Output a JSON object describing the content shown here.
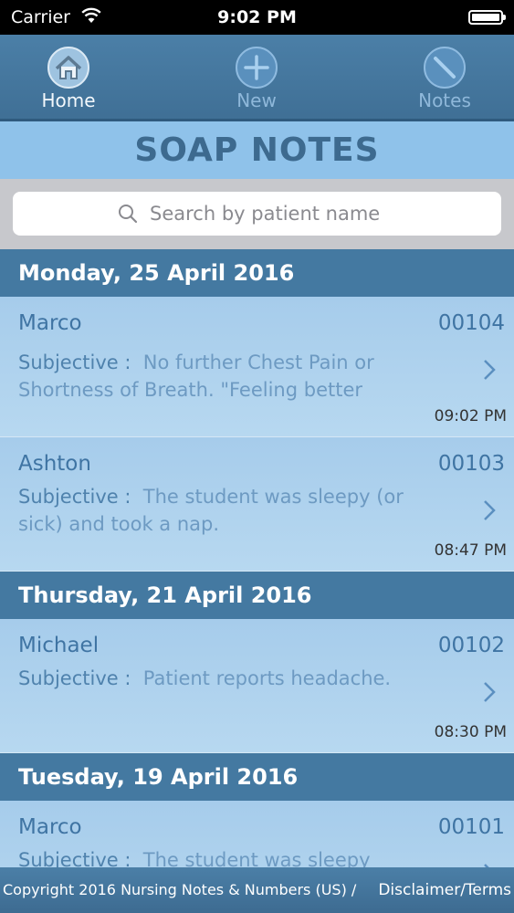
{
  "status_bar": {
    "carrier": "Carrier",
    "time": "9:02 PM"
  },
  "tabs": [
    {
      "label": "Home",
      "icon": "home-icon"
    },
    {
      "label": "New",
      "icon": "plus-icon"
    },
    {
      "label": "Notes",
      "icon": "pencil-icon"
    }
  ],
  "page_title": "SOAP NOTES",
  "search": {
    "placeholder": "Search by patient name"
  },
  "sections": [
    {
      "date": "Monday, 25 April 2016",
      "notes": [
        {
          "name": "Marco",
          "id": "00104",
          "label": "Subjective :",
          "text": "No further Chest Pain or Shortness of Breath. \"Feeling better",
          "time": "09:02 PM"
        },
        {
          "name": "Ashton",
          "id": "00103",
          "label": "Subjective :",
          "text": "The student was sleepy (or sick) and took a nap.",
          "time": "08:47 PM"
        }
      ]
    },
    {
      "date": "Thursday, 21 April 2016",
      "notes": [
        {
          "name": "Michael",
          "id": "00102",
          "label": "Subjective :",
          "text": "Patient reports headache.",
          "time": "08:30 PM"
        }
      ]
    },
    {
      "date": "Tuesday, 19 April 2016",
      "notes": [
        {
          "name": "Marco",
          "id": "00101",
          "label": "Subjective :",
          "text": "The student was sleepy",
          "time": ""
        }
      ]
    }
  ],
  "footer": {
    "copyright": "Copyright 2016 Nursing Notes & Numbers (US) /",
    "disclaimer": "Disclaimer/Terms"
  },
  "colors": {
    "header_blue": "#4479a1",
    "title_blue": "#3d6a8f",
    "row_blue": "#a6cceb"
  }
}
